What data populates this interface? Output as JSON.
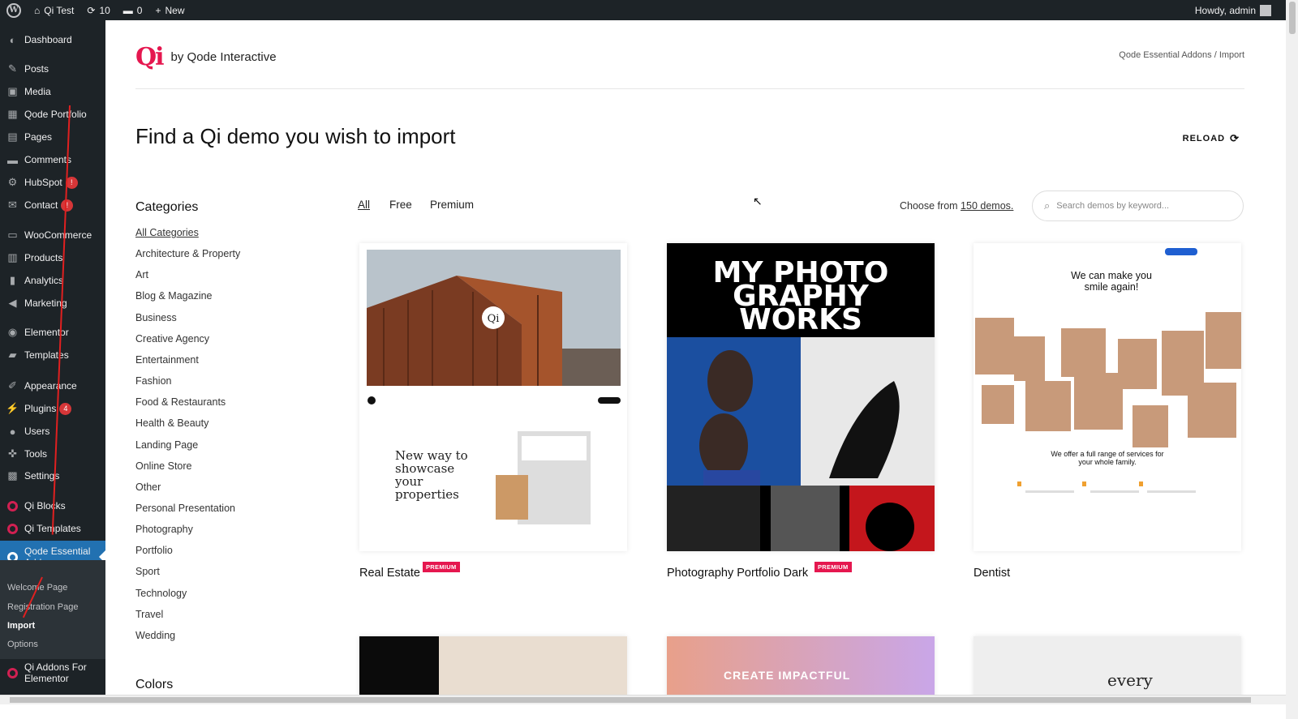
{
  "admin_bar": {
    "site_name": "Qi Test",
    "updates_count": "10",
    "comments_count": "0",
    "new_label": "New",
    "howdy": "Howdy, admin"
  },
  "sidebar": {
    "items": [
      {
        "label": "Dashboard",
        "icon": "dashboard-icon"
      },
      {
        "label": "Posts",
        "icon": "pin-icon"
      },
      {
        "label": "Media",
        "icon": "media-icon"
      },
      {
        "label": "Qode Portfolio",
        "icon": "grid-icon"
      },
      {
        "label": "Pages",
        "icon": "pages-icon"
      },
      {
        "label": "Comments",
        "icon": "comment-icon"
      },
      {
        "label": "HubSpot",
        "icon": "hubspot-icon",
        "badge": "!"
      },
      {
        "label": "Contact",
        "icon": "mail-icon",
        "badge": "!"
      },
      {
        "label": "WooCommerce",
        "icon": "woo-icon"
      },
      {
        "label": "Products",
        "icon": "archive-icon"
      },
      {
        "label": "Analytics",
        "icon": "chart-icon"
      },
      {
        "label": "Marketing",
        "icon": "megaphone-icon"
      },
      {
        "label": "Elementor",
        "icon": "elementor-icon"
      },
      {
        "label": "Templates",
        "icon": "folder-icon"
      },
      {
        "label": "Appearance",
        "icon": "brush-icon"
      },
      {
        "label": "Plugins",
        "icon": "plug-icon",
        "badge": "4"
      },
      {
        "label": "Users",
        "icon": "user-icon"
      },
      {
        "label": "Tools",
        "icon": "wrench-icon"
      },
      {
        "label": "Settings",
        "icon": "settings-icon"
      },
      {
        "label": "Qi Blocks",
        "icon": "qi-icon"
      },
      {
        "label": "Qi Templates",
        "icon": "qi-icon"
      },
      {
        "label": "Qode Essential Addons",
        "icon": "qi-icon",
        "active": true
      },
      {
        "label": "Qi Addons For Elementor",
        "icon": "qi-icon"
      }
    ],
    "submenu": [
      "Welcome Page",
      "Registration Page",
      "Import",
      "Options"
    ]
  },
  "header": {
    "brand_text": "by Qode Interactive",
    "breadcrumb": "Qode Essential Addons / Import"
  },
  "main": {
    "headline": "Find a Qi demo you wish to import",
    "reload_label": "RELOAD",
    "categories_title": "Categories",
    "categories": [
      "All Categories",
      "Architecture & Property",
      "Art",
      "Blog & Magazine",
      "Business",
      "Creative Agency",
      "Entertainment",
      "Fashion",
      "Food & Restaurants",
      "Health & Beauty",
      "Landing Page",
      "Online Store",
      "Other",
      "Personal Presentation",
      "Photography",
      "Portfolio",
      "Sport",
      "Technology",
      "Travel",
      "Wedding"
    ],
    "colors_title": "Colors",
    "filters": [
      "All",
      "Free",
      "Premium"
    ],
    "choose_prefix": "Choose from",
    "demo_count_link": "150 demos.",
    "search_placeholder": "Search demos by keyword...",
    "demos": [
      {
        "title": "Real Estate",
        "badge": "PREMIUM",
        "preview_text": "New way to showcase your properties"
      },
      {
        "title": "Photography Portfolio Dark",
        "badge": "PREMIUM",
        "preview_text": "MY PHOTO GRAPHY WORKS"
      },
      {
        "title": "Dentist",
        "preview_text": "We can make you smile again!",
        "preview_sub": "We offer a full range of services for your whole family."
      }
    ],
    "second_row_text": [
      "CREATE IMPACTFUL",
      "every"
    ]
  },
  "colors": {
    "admin_bg": "#1d2327",
    "active_menu": "#2271b1",
    "brand": "#e5174f",
    "badge": "#d63638"
  }
}
